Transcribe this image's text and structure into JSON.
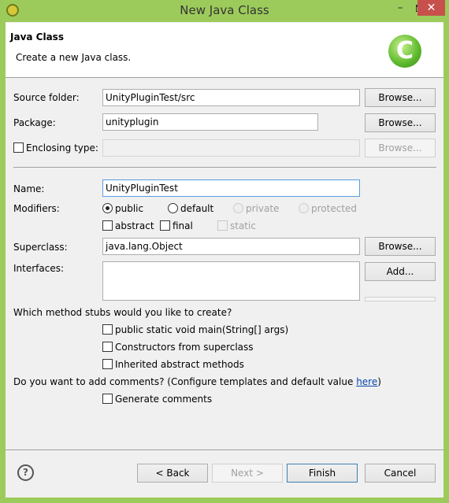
{
  "window": {
    "title": "New Java Class",
    "minimize": "–",
    "close": "✕"
  },
  "header": {
    "title": "Java Class",
    "description": "Create a new Java class.",
    "icon_letter": "C"
  },
  "source_folder": {
    "label": "Source folder:",
    "value": "UnityPluginTest/src",
    "browse": "Browse..."
  },
  "package": {
    "label": "Package:",
    "value": "unityplugin",
    "browse": "Browse..."
  },
  "enclosing": {
    "label": "Enclosing type:",
    "value": "",
    "browse": "Browse...",
    "checked": false
  },
  "name": {
    "label": "Name:",
    "value": "UnityPluginTest"
  },
  "modifiers": {
    "label": "Modifiers:",
    "radios": [
      {
        "label": "public",
        "selected": true,
        "enabled": true
      },
      {
        "label": "default",
        "selected": false,
        "enabled": true
      },
      {
        "label": "private",
        "selected": false,
        "enabled": false
      },
      {
        "label": "protected",
        "selected": false,
        "enabled": false
      }
    ],
    "checks": [
      {
        "label": "abstract",
        "enabled": true
      },
      {
        "label": "final",
        "enabled": true
      },
      {
        "label": "static",
        "enabled": false
      }
    ]
  },
  "superclass": {
    "label": "Superclass:",
    "value": "java.lang.Object",
    "browse": "Browse..."
  },
  "interfaces": {
    "label": "Interfaces:",
    "add": "Add..."
  },
  "stubs": {
    "question": "Which method stubs would you like to create?",
    "options": [
      "public static void main(String[] args)",
      "Constructors from superclass",
      "Inherited abstract methods"
    ]
  },
  "comments": {
    "question": "Do you want to add comments? (Configure templates and default value ",
    "link": "here",
    "close_paren": ")",
    "option": "Generate comments"
  },
  "footer": {
    "back": "< Back",
    "next": "Next >",
    "finish": "Finish",
    "cancel": "Cancel",
    "help": "?"
  }
}
